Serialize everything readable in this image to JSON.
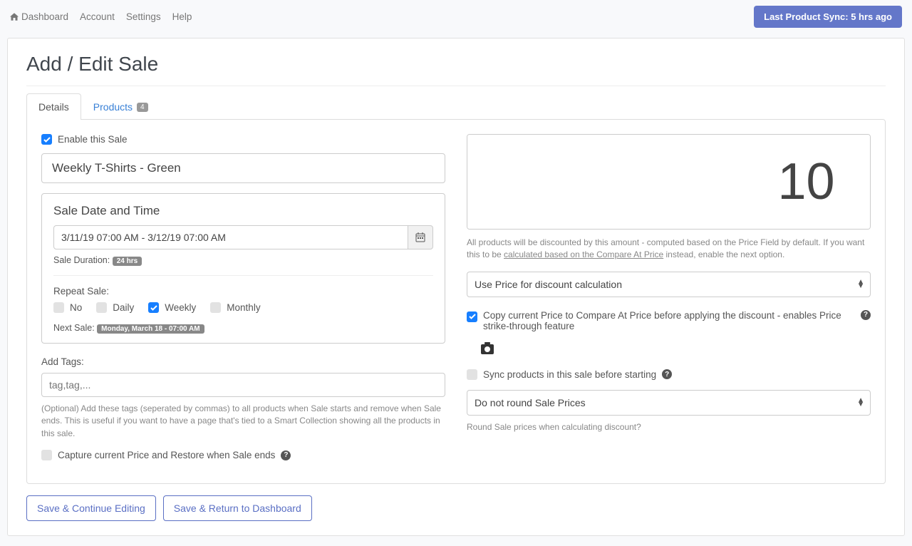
{
  "topnav": {
    "dashboard": "Dashboard",
    "account": "Account",
    "settings": "Settings",
    "help": "Help"
  },
  "sync_button": "Last Product Sync: 5 hrs ago",
  "page_title": "Add / Edit Sale",
  "tabs": {
    "details": "Details",
    "products": "Products",
    "products_count": "4"
  },
  "enable_label": "Enable this Sale",
  "sale_name": "Weekly T-Shirts - Green",
  "datebox": {
    "title": "Sale Date and Time",
    "range": "3/11/19 07:00 AM - 3/12/19 07:00 AM",
    "duration_label": "Sale Duration:",
    "duration_badge": "24 hrs",
    "repeat_label": "Repeat Sale:",
    "opts": {
      "no": "No",
      "daily": "Daily",
      "weekly": "Weekly",
      "monthly": "Monthly"
    },
    "next_label": "Next Sale:",
    "next_badge": "Monday, March 18 - 07:00 AM"
  },
  "tags": {
    "label": "Add Tags:",
    "placeholder": "tag,tag,...",
    "help": "(Optional) Add these tags (seperated by commas) to all products when Sale starts and remove when Sale ends. This is useful if you want to have a page that's tied to a Smart Collection showing all the products in this sale."
  },
  "capture_label": "Capture current Price and Restore when Sale ends",
  "discount_value": "10",
  "discount_suffix": "%",
  "discount_note_a": "All products will be discounted by this amount - computed based on the Price Field by default. If you want this to be ",
  "discount_note_link": "calculated based on the Compare At Price",
  "discount_note_b": " instead, enable the next option.",
  "calc_select": "Use Price for discount calculation",
  "copy_label": "Copy current Price to Compare At Price before applying the discount - enables Price strike-through feature",
  "sync_label": "Sync products in this sale before starting",
  "round_select": "Do not round Sale Prices",
  "round_help": "Round Sale prices when calculating discount?",
  "footer": {
    "save_continue": "Save & Continue Editing",
    "save_return": "Save & Return to Dashboard"
  }
}
